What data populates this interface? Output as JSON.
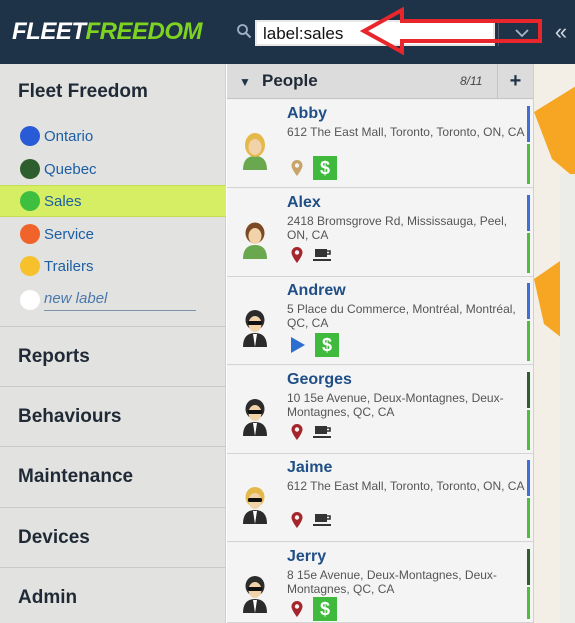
{
  "topbar": {
    "logo_part1": "FLEET",
    "logo_part2": "FREEDOM",
    "search_value": "label:sales",
    "collapse_glyph": "«",
    "icons": [
      "search-icon",
      "chevron-down-icon",
      "collapse-icon"
    ]
  },
  "sidebar": {
    "title": "Fleet Freedom",
    "labels": [
      {
        "name": "Ontario",
        "color": "#2a5bd7"
      },
      {
        "name": "Quebec",
        "color": "#2e5e2e"
      },
      {
        "name": "Sales",
        "color": "#3fbf3f",
        "active": true
      },
      {
        "name": "Service",
        "color": "#f0642c"
      },
      {
        "name": "Trailers",
        "color": "#f6c12c"
      }
    ],
    "new_label_placeholder": "new label",
    "sections": [
      "Reports",
      "Behaviours",
      "Maintenance",
      "Devices",
      "Admin"
    ]
  },
  "people_panel": {
    "title": "People",
    "count": "8/11",
    "add_label": "+",
    "people": [
      {
        "name": "Abby",
        "address": "612 The East Mall, Toronto, Toronto, ON, CA",
        "status": [
          "location-pin-icon",
          "dollar-icon"
        ],
        "avatar": "blonde-user-icon",
        "bar_color": "#3f6fd6"
      },
      {
        "name": "Alex",
        "address": "2418 Bromsgrove Rd, Mississauga, Peel, ON, CA",
        "status": [
          "location-pin-icon",
          "coffee-icon"
        ],
        "avatar": "brown-user-icon",
        "bar_color": "#3f6fd6"
      },
      {
        "name": "Andrew",
        "address": "5 Place du Commerce, Montréal, Montréal, QC, CA",
        "status": [
          "play-icon",
          "dollar-icon"
        ],
        "avatar": "agent-user-icon",
        "bar_color": "#3f6fd6"
      },
      {
        "name": "Georges",
        "address": "10 15e Avenue, Deux-Montagnes, Deux-Montagnes, QC, CA",
        "status": [
          "location-pin-icon",
          "coffee-icon"
        ],
        "avatar": "agent-user-icon",
        "bar_color": "#2e5e2e"
      },
      {
        "name": "Jaime",
        "address": "612 The East Mall, Toronto, Toronto, ON, CA",
        "status": [
          "location-pin-icon",
          "coffee-icon"
        ],
        "avatar": "agent-blonde-user-icon",
        "bar_color": "#3f6fd6"
      },
      {
        "name": "Jerry",
        "address": "8 15e Avenue, Deux-Montagnes, Deux-Montagnes, QC, CA",
        "status": [
          "location-pin-icon",
          "dollar-icon"
        ],
        "avatar": "agent-user-icon",
        "bar_color": "#2e5e2e"
      }
    ]
  },
  "colors": {
    "topbar_bg": "#1f3348",
    "logo_accent": "#7ed321",
    "active_label_bg": "#d6ee64",
    "annotation_arrow": "#e8262c",
    "map_accent": "#f7a623"
  }
}
